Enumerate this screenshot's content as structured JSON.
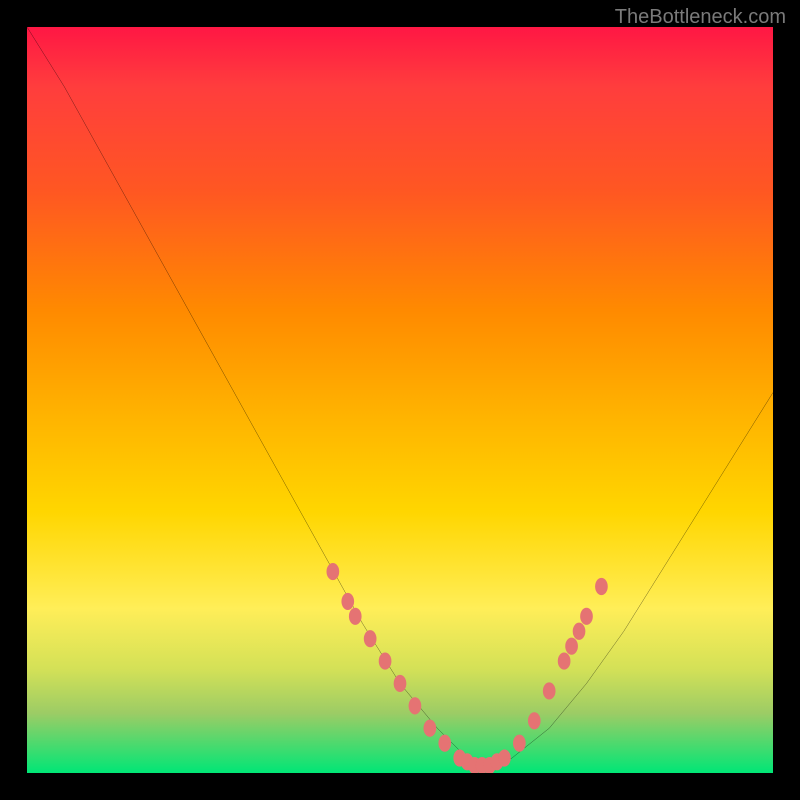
{
  "watermark": "TheBottleneck.com",
  "chart_data": {
    "type": "line",
    "title": "",
    "xlabel": "",
    "ylabel": "",
    "xlim": [
      0,
      100
    ],
    "ylim": [
      0,
      100
    ],
    "grid": false,
    "series": [
      {
        "name": "bottleneck-curve",
        "x": [
          0,
          5,
          10,
          15,
          20,
          25,
          30,
          35,
          40,
          45,
          50,
          55,
          57,
          59,
          61,
          63,
          65,
          70,
          75,
          80,
          85,
          90,
          95,
          100
        ],
        "values": [
          100,
          92,
          83,
          74,
          65,
          56,
          47,
          38,
          29,
          20,
          12,
          6,
          4,
          2,
          1,
          1,
          2,
          6,
          12,
          19,
          27,
          35,
          43,
          51
        ],
        "color": "#000000"
      }
    ],
    "markers": {
      "name": "highlight-dots",
      "color": "#e57373",
      "points": [
        {
          "x": 41,
          "y": 27
        },
        {
          "x": 43,
          "y": 23
        },
        {
          "x": 44,
          "y": 21
        },
        {
          "x": 46,
          "y": 18
        },
        {
          "x": 48,
          "y": 15
        },
        {
          "x": 50,
          "y": 12
        },
        {
          "x": 52,
          "y": 9
        },
        {
          "x": 54,
          "y": 6
        },
        {
          "x": 56,
          "y": 4
        },
        {
          "x": 58,
          "y": 2
        },
        {
          "x": 59,
          "y": 1.5
        },
        {
          "x": 60,
          "y": 1
        },
        {
          "x": 61,
          "y": 1
        },
        {
          "x": 62,
          "y": 1
        },
        {
          "x": 63,
          "y": 1.5
        },
        {
          "x": 64,
          "y": 2
        },
        {
          "x": 66,
          "y": 4
        },
        {
          "x": 68,
          "y": 7
        },
        {
          "x": 70,
          "y": 11
        },
        {
          "x": 72,
          "y": 15
        },
        {
          "x": 73,
          "y": 17
        },
        {
          "x": 74,
          "y": 19
        },
        {
          "x": 75,
          "y": 21
        },
        {
          "x": 77,
          "y": 25
        }
      ]
    },
    "background_gradient": {
      "top": "#ff1744",
      "bottom": "#00e676"
    }
  }
}
